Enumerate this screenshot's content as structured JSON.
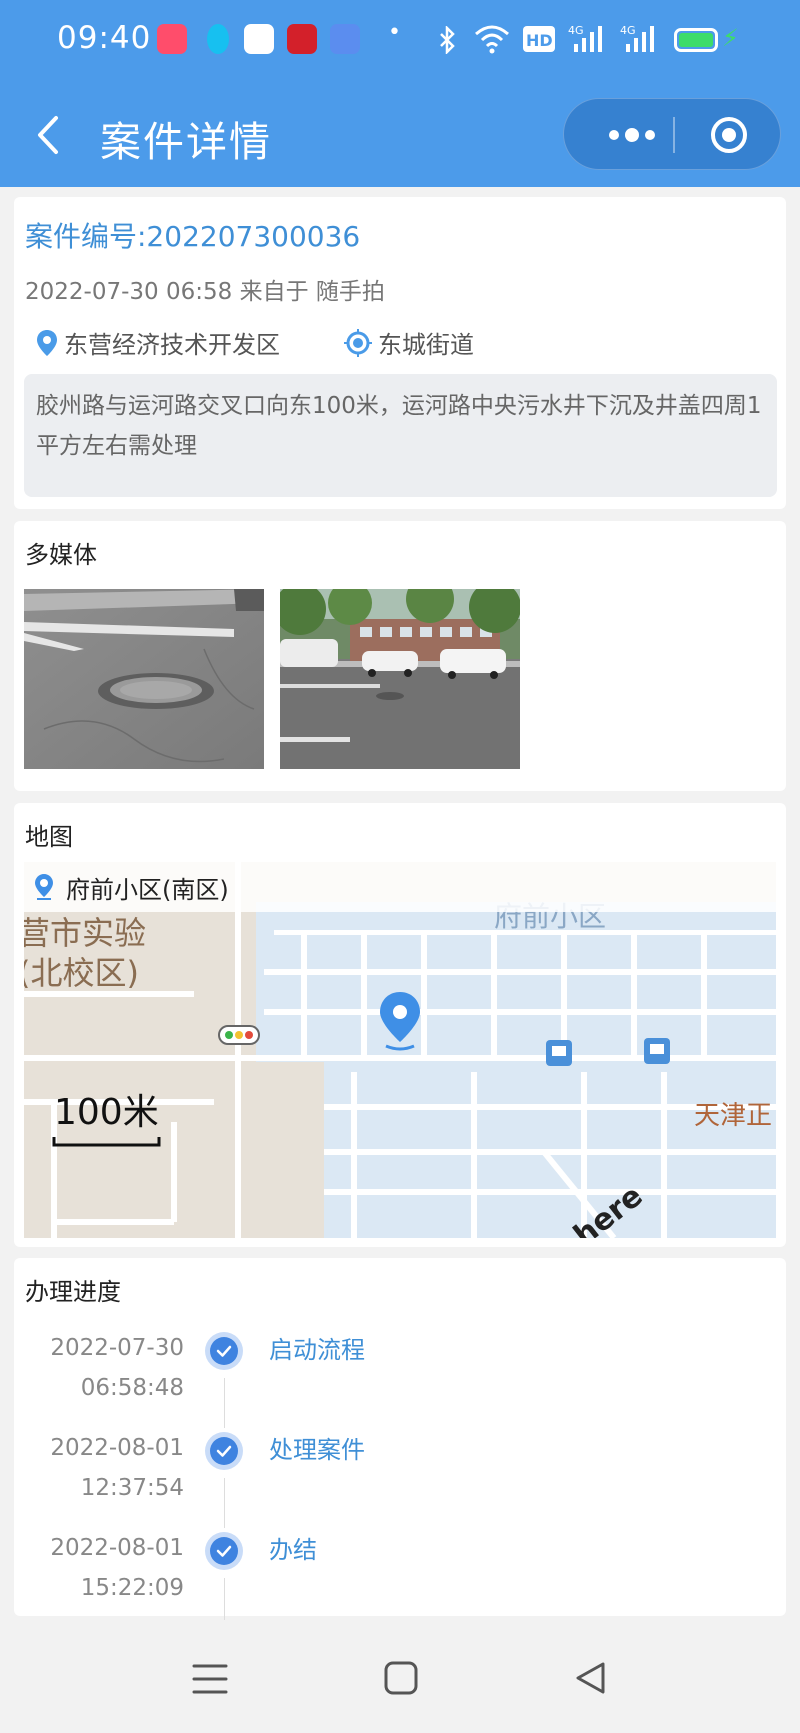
{
  "status_bar": {
    "time": "09:40"
  },
  "header": {
    "title": "案件详情",
    "back_icon": "chevron-left-icon",
    "menu_icon": "more-dots-icon",
    "close_icon": "target-icon"
  },
  "case": {
    "number": "案件编号:202207300036",
    "meta": "2022-07-30 06:58 来自于 随手拍",
    "district": "东营经济技术开发区",
    "street": "东城街道",
    "description": "胶州路与运河路交叉口向东100米，运河路中央污水井下沉及井盖四周1平方左右需处理"
  },
  "media": {
    "title": "多媒体"
  },
  "map": {
    "title": "地图",
    "address": "府前小区(南区)",
    "labels": {
      "school_line1": "营市实验",
      "school_line2": "(北校区)",
      "community": "府前小区",
      "tianjin": "天津正",
      "scale": "100米",
      "brand": "here"
    }
  },
  "progress": {
    "title": "办理进度",
    "steps": [
      {
        "date": "2022-07-30",
        "time": "06:58:48",
        "label": "启动流程"
      },
      {
        "date": "2022-08-01",
        "time": "12:37:54",
        "label": "处理案件"
      },
      {
        "date": "2022-08-01",
        "time": "15:22:09",
        "label": "办结"
      }
    ]
  },
  "colors": {
    "header_bg": "#4c9bea",
    "accent": "#3f8fd6",
    "timeline_dot": "#3f83e0"
  }
}
